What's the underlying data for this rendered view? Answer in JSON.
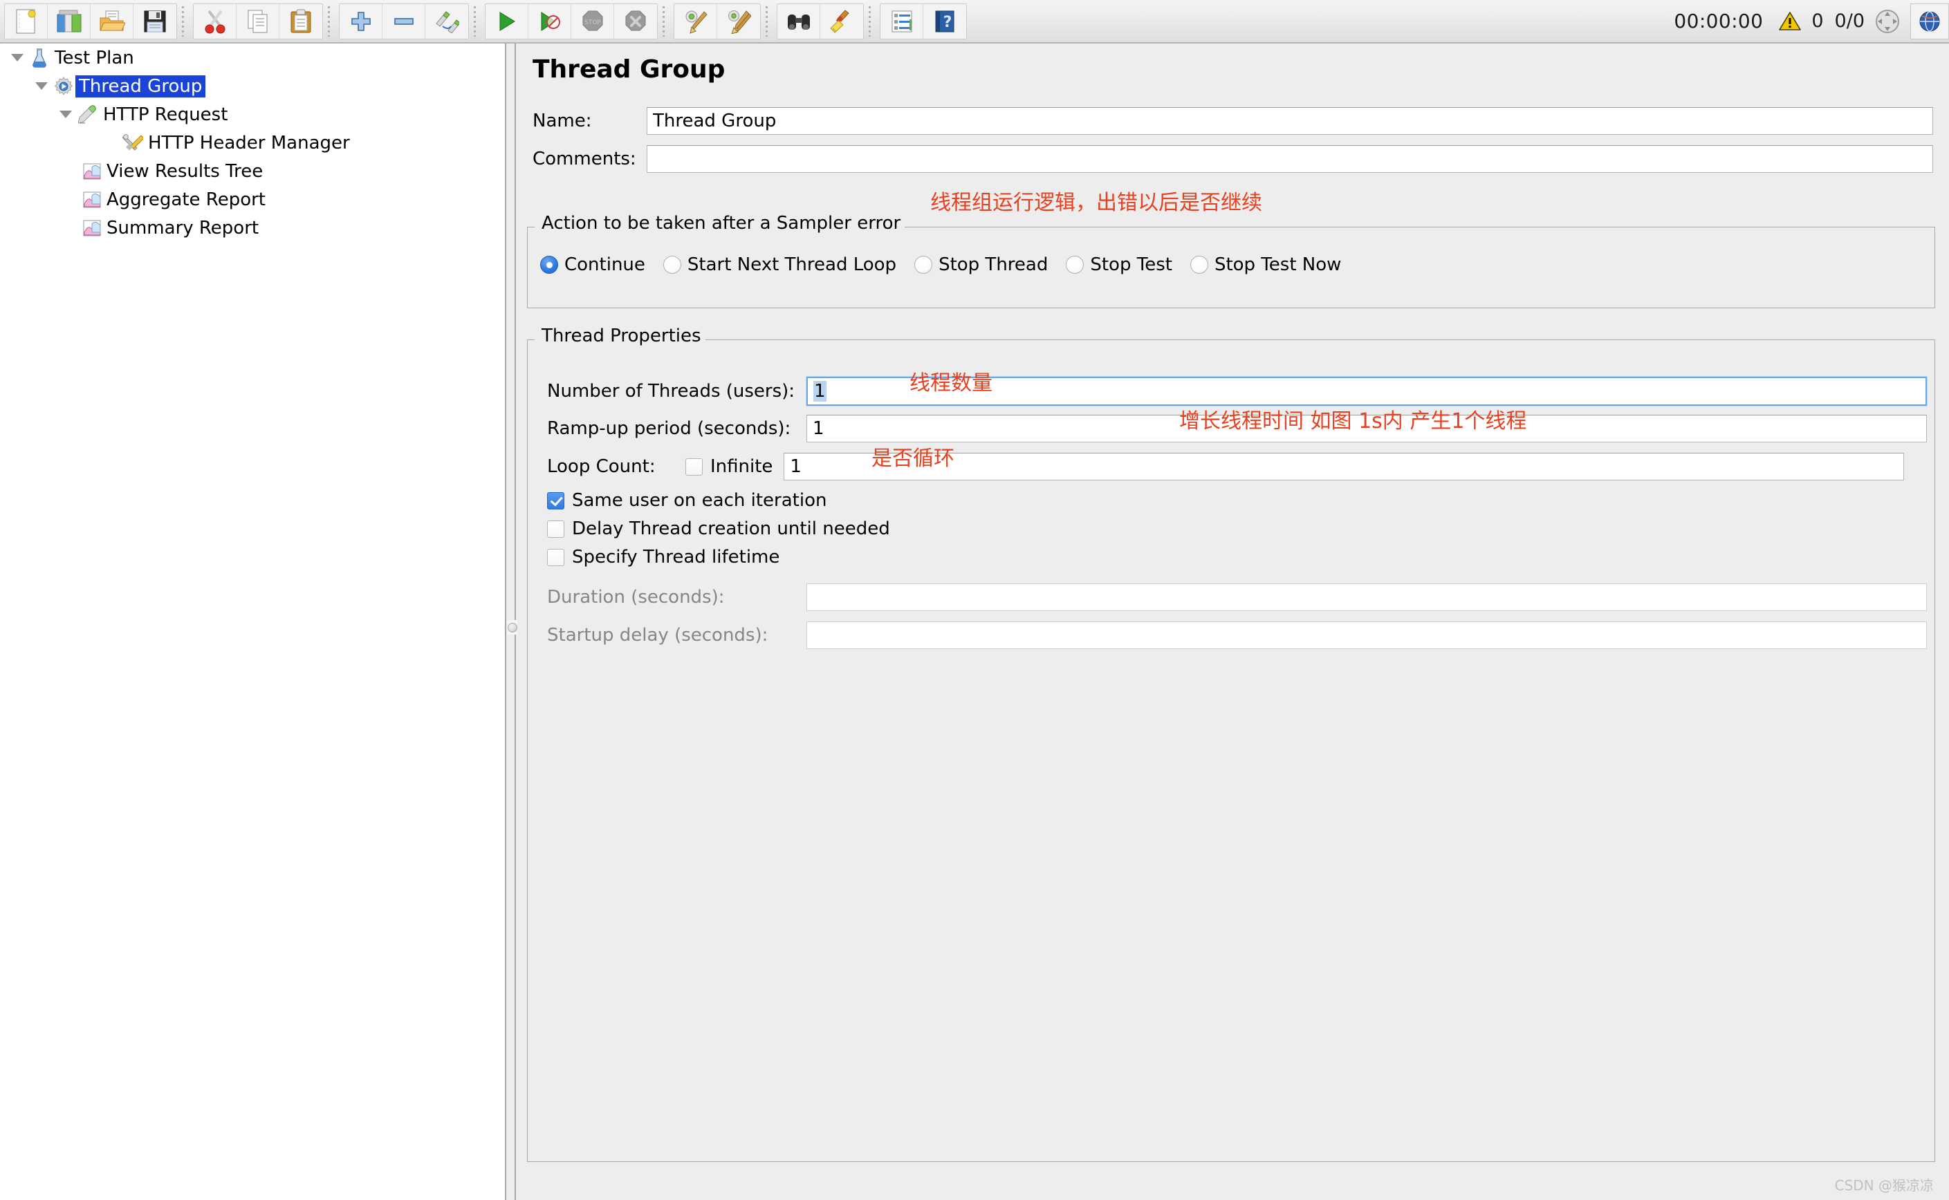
{
  "toolbar": {
    "groups": [
      {
        "name": "file-group",
        "buttons": [
          {
            "name": "new-button",
            "icon": "new-document-icon"
          },
          {
            "name": "templates-button",
            "icon": "templates-icon"
          },
          {
            "name": "open-button",
            "icon": "open-folder-icon"
          },
          {
            "name": "save-button",
            "icon": "floppy-save-icon"
          }
        ]
      },
      {
        "name": "edit-group",
        "buttons": [
          {
            "name": "cut-button",
            "icon": "scissors-icon"
          },
          {
            "name": "copy-button",
            "icon": "copy-pages-icon"
          },
          {
            "name": "paste-button",
            "icon": "clipboard-icon"
          }
        ]
      },
      {
        "name": "zoom-group",
        "buttons": [
          {
            "name": "zoom-in-button",
            "icon": "plus-icon"
          },
          {
            "name": "zoom-out-button",
            "icon": "minus-icon"
          },
          {
            "name": "toggle-button",
            "icon": "pencil-toggle-icon"
          }
        ]
      },
      {
        "name": "run-group",
        "buttons": [
          {
            "name": "start-button",
            "icon": "green-play-icon"
          },
          {
            "name": "start-no-pauses-button",
            "icon": "green-play-nopause-icon"
          },
          {
            "name": "stop-button",
            "icon": "stop-sign-icon"
          },
          {
            "name": "shutdown-button",
            "icon": "shutdown-x-icon"
          }
        ]
      },
      {
        "name": "clear-group",
        "buttons": [
          {
            "name": "clear-button",
            "icon": "gear-broom-icon"
          },
          {
            "name": "clear-all-button",
            "icon": "gear-broom-all-icon"
          }
        ]
      },
      {
        "name": "search-group",
        "buttons": [
          {
            "name": "search-button",
            "icon": "binoculars-icon"
          },
          {
            "name": "reset-search-button",
            "icon": "yellow-broom-icon"
          }
        ]
      },
      {
        "name": "help-group",
        "buttons": [
          {
            "name": "function-helper-button",
            "icon": "list-lines-icon"
          },
          {
            "name": "help-button",
            "icon": "blue-question-book-icon"
          }
        ]
      }
    ],
    "status": {
      "timer": "00:00:00",
      "warning_icon": "warning-triangle-icon",
      "warning_count": "0",
      "threads_running": "0/0",
      "expand_icon": "four-arrows-icon",
      "language_icon": "globe-icon"
    }
  },
  "tree": {
    "items": [
      {
        "label": "Test Plan",
        "icon": "test-plan-flask-icon",
        "depth": 0,
        "expanded": true,
        "selected": false
      },
      {
        "label": "Thread Group",
        "icon": "thread-group-gear-icon",
        "depth": 1,
        "expanded": true,
        "selected": true
      },
      {
        "label": "HTTP Request",
        "icon": "http-request-pipette-icon",
        "depth": 2,
        "expanded": true,
        "selected": false
      },
      {
        "label": "HTTP Header Manager",
        "icon": "header-manager-tools-icon",
        "depth": 3,
        "expanded": false,
        "selected": false
      },
      {
        "label": "View Results Tree",
        "icon": "results-chart-icon",
        "depth": 2,
        "expanded": false,
        "selected": false
      },
      {
        "label": "Aggregate Report",
        "icon": "results-chart-icon",
        "depth": 2,
        "expanded": false,
        "selected": false
      },
      {
        "label": "Summary Report",
        "icon": "results-chart-icon",
        "depth": 2,
        "expanded": false,
        "selected": false
      }
    ]
  },
  "detail": {
    "title": "Thread Group",
    "name_label": "Name:",
    "name_value": "Thread Group",
    "comments_label": "Comments:",
    "comments_value": "",
    "sampler_error": {
      "legend": "Action to be taken after a Sampler error",
      "options": [
        {
          "label": "Continue",
          "selected": true
        },
        {
          "label": "Start Next Thread Loop",
          "selected": false
        },
        {
          "label": "Stop Thread",
          "selected": false
        },
        {
          "label": "Stop Test",
          "selected": false
        },
        {
          "label": "Stop Test Now",
          "selected": false
        }
      ]
    },
    "thread_properties": {
      "legend": "Thread Properties",
      "num_threads_label": "Number of Threads (users):",
      "num_threads_value": "1",
      "rampup_label": "Ramp-up period (seconds):",
      "rampup_value": "1",
      "loop_count_label": "Loop Count:",
      "infinite_label": "Infinite",
      "infinite_checked": false,
      "loop_count_value": "1",
      "checkboxes": [
        {
          "label": "Same user on each iteration",
          "checked": true
        },
        {
          "label": "Delay Thread creation until needed",
          "checked": false
        },
        {
          "label": "Specify Thread lifetime",
          "checked": false
        }
      ],
      "duration_label": "Duration (seconds):",
      "duration_value": "",
      "startup_delay_label": "Startup delay (seconds):",
      "startup_delay_value": ""
    }
  },
  "annotations": [
    {
      "name": "annotation-sampler-error",
      "text": "线程组运行逻辑，出错以后是否继续"
    },
    {
      "name": "annotation-thread-count",
      "text": "线程数量"
    },
    {
      "name": "annotation-rampup",
      "text": "增长线程时间 如图 1s内 产生1个线程"
    },
    {
      "name": "annotation-loop",
      "text": "是否循环"
    }
  ],
  "watermark": "CSDN @猴凉凉",
  "colors": {
    "selection_blue": "#1a44d8",
    "annotation_red": "#e8411f",
    "panel_bg": "#ededed",
    "field_bg": "#ffffff"
  }
}
